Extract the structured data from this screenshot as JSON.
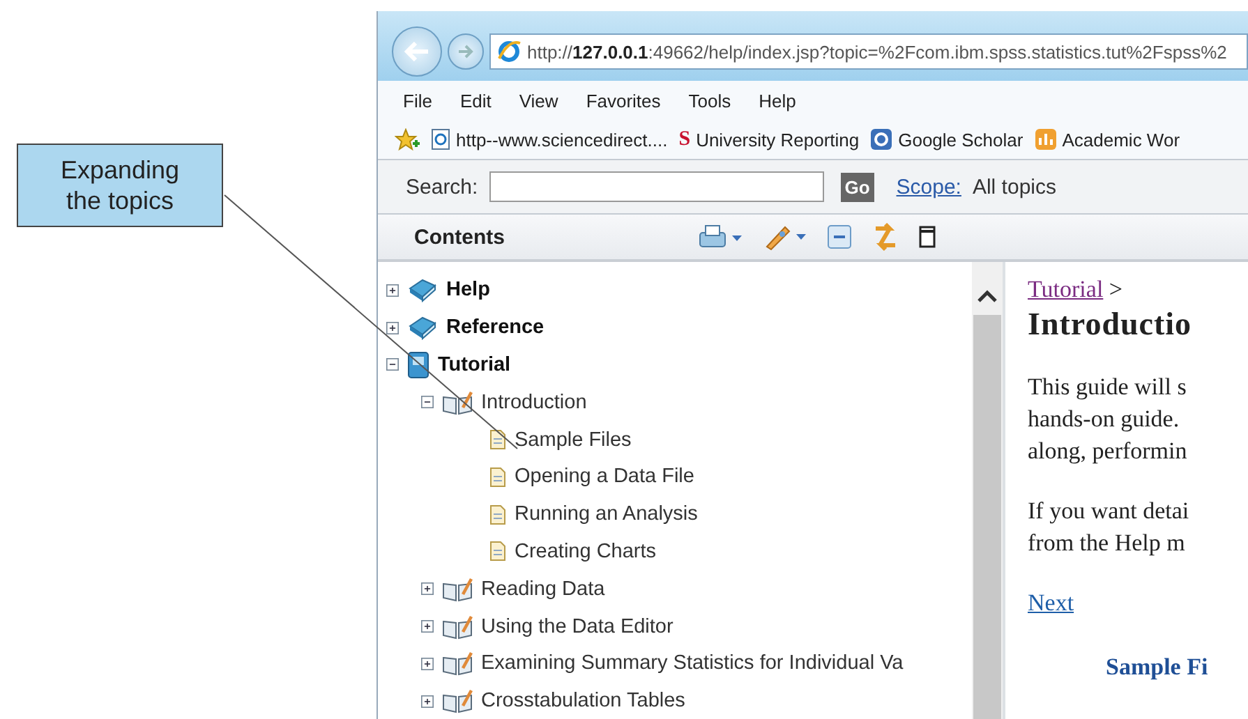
{
  "callout": {
    "text": "Expanding the topics"
  },
  "address_bar": {
    "url": "http://**127.0.0.1**:49662/help/index.jsp?topic=%2Fcom.ibm.spss.statistics.tut%2Fspss%2"
  },
  "menu": [
    "File",
    "Edit",
    "View",
    "Favorites",
    "Tools",
    "Help"
  ],
  "favorites": [
    {
      "label": "http--www.sciencedirect....",
      "kind": "page"
    },
    {
      "label": "University Reporting",
      "kind": "letter",
      "icon_text": "S"
    },
    {
      "label": "Google Scholar",
      "kind": "scholar"
    },
    {
      "label": "Academic Wor",
      "kind": "chart"
    }
  ],
  "search": {
    "label": "Search:",
    "button": "Go",
    "scope_link": "Scope:",
    "scope_value": "All topics"
  },
  "contents": {
    "title": "Contents"
  },
  "tree": [
    {
      "label": "Help",
      "kind": "collection",
      "expanded": false
    },
    {
      "label": "Reference",
      "kind": "collection",
      "expanded": false
    },
    {
      "label": "Tutorial",
      "kind": "manual",
      "expanded": true,
      "children": [
        {
          "label": "Introduction",
          "kind": "chapter",
          "expanded": true,
          "children": [
            {
              "label": "Sample Files",
              "kind": "topic"
            },
            {
              "label": "Opening a Data File",
              "kind": "topic"
            },
            {
              "label": "Running an Analysis",
              "kind": "topic"
            },
            {
              "label": "Creating Charts",
              "kind": "topic"
            }
          ]
        },
        {
          "label": "Reading Data",
          "kind": "chapter",
          "expanded": false
        },
        {
          "label": "Using the Data Editor",
          "kind": "chapter",
          "expanded": false
        },
        {
          "label": "Examining Summary Statistics for Individual Va",
          "kind": "chapter",
          "expanded": false
        },
        {
          "label": "Crosstabulation Tables",
          "kind": "chapter",
          "expanded": false
        }
      ]
    }
  ],
  "article": {
    "breadcrumb_link": "Tutorial",
    "breadcrumb_sep": ">",
    "heading": "Introductio",
    "paragraphs": [
      [
        "This guide will s",
        "hands-on guide.",
        "along, performin"
      ],
      [
        "If you want detai",
        "from the Help m"
      ]
    ],
    "next_link": "Next",
    "next_heading": "Sample Fi"
  }
}
